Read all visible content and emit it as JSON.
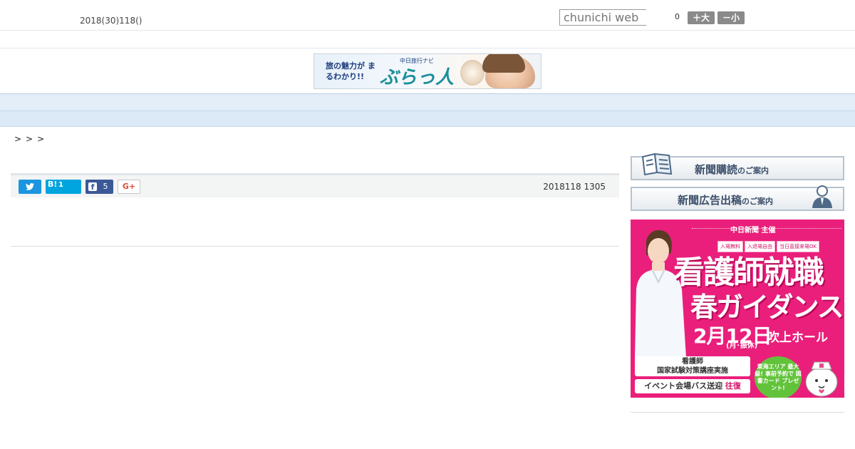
{
  "header": {
    "date": "2018(30)118()",
    "search_placeholder": "chunichi web",
    "font_count": "0",
    "font_big_label": "＋大",
    "font_small_label": "－小"
  },
  "banner_top": {
    "tagline": "旅の魅力が まるわかり!!",
    "sub": "中日旅行ナビ",
    "logo": "ぶらっ人"
  },
  "nav": {
    "items": [
      "",
      "",
      "",
      "",
      "",
      "",
      "",
      "",
      ""
    ]
  },
  "breadcrumb": ">>>",
  "share": {
    "hatena_label": "B!",
    "hatena_count": "1",
    "facebook_label": "f",
    "facebook_count": "5",
    "gplus_label": "G+",
    "timestamp": "2018118 1305"
  },
  "sidebar": {
    "subscribe_main": "新聞購読",
    "subscribe_suffix": "のご案内",
    "ad_main": "新聞広告出稿",
    "ad_suffix": "のご案内"
  },
  "ad": {
    "organizer": "中日新聞 主催",
    "tags": [
      "入場無料",
      "入退場自由",
      "当日直接来場OK"
    ],
    "title1": "看護師就職",
    "title2": "春ガイダンス",
    "date": "2月12日",
    "day": "(月･振休)",
    "venue": "吹上ホール",
    "box1_line1": "看護師",
    "box1_line2": "国家試験対策講座実施",
    "box2_text": "イベント会場バス送迎",
    "box2_badge": "往復",
    "bubble": "東海エリア 最大級! 事前予約で 図書カード プレゼント!"
  },
  "colors": {
    "nav_bg": "#e4eef8",
    "twitter": "#1b95e0",
    "hatena": "#00a4de",
    "facebook": "#3b5998",
    "ad_pink": "#ea1f7b"
  }
}
